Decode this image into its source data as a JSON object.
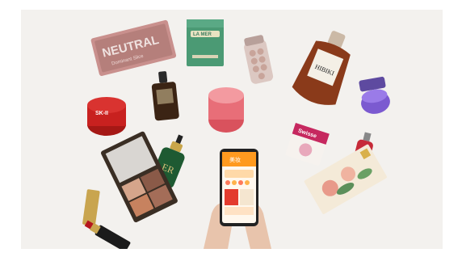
{
  "photo": {
    "palette_label": "NEUTRAL",
    "palette_sub": "Dominant Slice",
    "cream_box_label": "LA MER",
    "serum_red_label": "SK-II",
    "er_label": "ER",
    "whisky_label": "HIBIKI",
    "phone_app_header": "美妆",
    "supplement_label": "Swisse"
  },
  "colors": {
    "background": "#f3f1ee",
    "palette_box": "#c9908d",
    "la_mer_box": "#4b9a74",
    "red_jar": "#c8211f",
    "phone_ui": "#ff9a1f",
    "whisky": "#8a3a1a",
    "purple_jar": "#7b5ad0"
  }
}
